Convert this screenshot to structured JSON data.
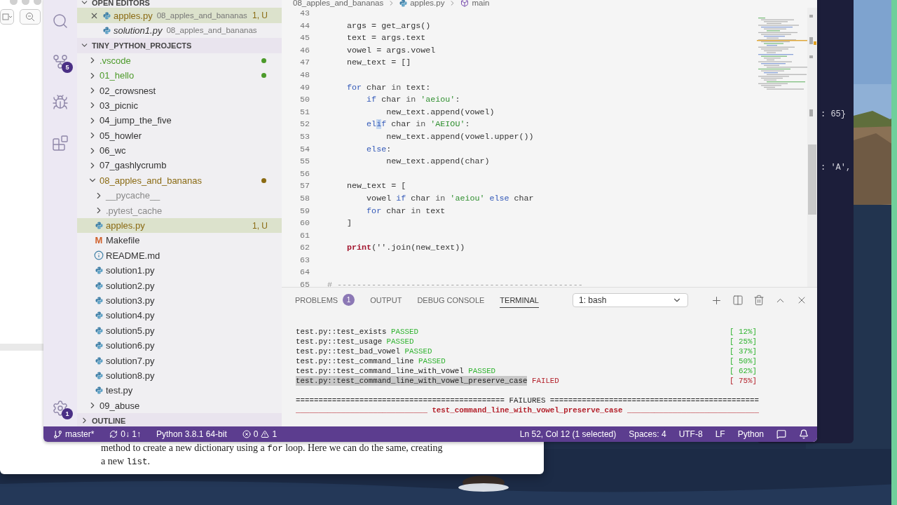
{
  "reader_window": {
    "paragraph": [
      [
        {
          "kind": "text",
          "text": "method to create a new dictionary using a "
        },
        {
          "kind": "code",
          "text": "for"
        },
        {
          "kind": "text",
          "text": " loop. Here we can do the same, creating"
        }
      ],
      [
        {
          "kind": "text",
          "text": "a new "
        },
        {
          "kind": "code",
          "text": "list"
        },
        {
          "kind": "text",
          "text": "."
        }
      ]
    ]
  },
  "terminal_window": {
    "lines": [
      ": 65}",
      ": 'A',"
    ]
  },
  "activity_bar": [
    {
      "kind": "search"
    },
    {
      "kind": "source_control",
      "badge": "5"
    },
    {
      "kind": "debug"
    },
    {
      "kind": "extensions"
    },
    {
      "kind": "settings",
      "badge": "1"
    }
  ],
  "open_editors": {
    "title": "OPEN EDITORS",
    "items": [
      {
        "name": "apples.py",
        "folder": "08_apples_and_bananas",
        "badge": "1, U",
        "selected": true,
        "preview": false,
        "color": "#8a6a12"
      },
      {
        "name": "solution1.py",
        "folder": "08_apples_and_bananas",
        "selected": false,
        "preview": true
      }
    ]
  },
  "explorer": {
    "title": "TINY_PYTHON_PROJECTS",
    "items": [
      {
        "name": ".vscode",
        "kind": "folder",
        "expanded": false,
        "color": "#4c9a2a",
        "dot": true
      },
      {
        "name": "01_hello",
        "kind": "folder",
        "expanded": false,
        "color": "#4c9a2a",
        "dot": true
      },
      {
        "name": "02_crowsnest",
        "kind": "folder",
        "expanded": false
      },
      {
        "name": "03_picnic",
        "kind": "folder",
        "expanded": false
      },
      {
        "name": "04_jump_the_five",
        "kind": "folder",
        "expanded": false
      },
      {
        "name": "05_howler",
        "kind": "folder",
        "expanded": false
      },
      {
        "name": "06_wc",
        "kind": "folder",
        "expanded": false
      },
      {
        "name": "07_gashlycrumb",
        "kind": "folder",
        "expanded": false
      },
      {
        "name": "08_apples_and_bananas",
        "kind": "folder",
        "expanded": true,
        "color": "#8a6a12",
        "dot": true,
        "children": [
          {
            "name": "__pycache__",
            "kind": "folder",
            "expanded": false,
            "color": "#8a8a8a"
          },
          {
            "name": ".pytest_cache",
            "kind": "folder",
            "expanded": false,
            "color": "#8a8a8a"
          },
          {
            "name": "apples.py",
            "kind": "python",
            "selected": true,
            "color": "#8a6a12",
            "badge": "1, U"
          },
          {
            "name": "Makefile",
            "kind": "makefile",
            "icon_glyph": "M",
            "selected": false
          },
          {
            "name": "README.md",
            "kind": "info",
            "selected": false
          },
          {
            "name": "solution1.py",
            "kind": "python",
            "selected": false
          },
          {
            "name": "solution2.py",
            "kind": "python",
            "selected": false
          },
          {
            "name": "solution3.py",
            "kind": "python",
            "selected": false
          },
          {
            "name": "solution4.py",
            "kind": "python",
            "selected": false
          },
          {
            "name": "solution5.py",
            "kind": "python",
            "selected": false
          },
          {
            "name": "solution6.py",
            "kind": "python",
            "selected": false
          },
          {
            "name": "solution7.py",
            "kind": "python",
            "selected": false
          },
          {
            "name": "solution8.py",
            "kind": "python",
            "selected": false
          },
          {
            "name": "test.py",
            "kind": "python",
            "selected": false
          }
        ]
      },
      {
        "name": "09_abuse",
        "kind": "folder",
        "expanded": false
      }
    ]
  },
  "outline": {
    "title": "OUTLINE",
    "expanded": false
  },
  "breadcrumb": [
    {
      "kind": "folder",
      "text": "08_apples_and_bananas"
    },
    {
      "kind": "python",
      "text": "apples.py"
    },
    {
      "kind": "symbol",
      "text": "main"
    }
  ],
  "code": [
    {
      "number": "43"
    },
    {
      "number": "44",
      "tokens": [
        {
          "text": "    args = get_args()",
          "kind": "plain"
        }
      ]
    },
    {
      "number": "45",
      "tokens": [
        {
          "text": "    text = args.text",
          "kind": "plain"
        }
      ]
    },
    {
      "number": "46",
      "tokens": [
        {
          "text": "    vowel = args.vowel",
          "kind": "plain"
        }
      ]
    },
    {
      "number": "47",
      "tokens": [
        {
          "text": "    new_text = []",
          "kind": "plain"
        }
      ]
    },
    {
      "number": "48"
    },
    {
      "number": "49",
      "tokens": [
        {
          "text": "    for",
          "kind": "keyword"
        },
        {
          "text": " char ",
          "kind": "plain"
        },
        {
          "text": "in",
          "kind": "operator"
        },
        {
          "text": " text:",
          "kind": "plain"
        }
      ]
    },
    {
      "number": "50",
      "tokens": [
        {
          "text": "        if",
          "kind": "keyword"
        },
        {
          "text": " char ",
          "kind": "plain"
        },
        {
          "text": "in",
          "kind": "operator"
        },
        {
          "text": " 'aeiou'",
          "kind": "string"
        },
        {
          "text": ":",
          "kind": "plain"
        }
      ]
    },
    {
      "number": "51",
      "tokens": [
        {
          "text": "            new_text.append(vowel)",
          "kind": "plain"
        }
      ]
    },
    {
      "number": "52",
      "tokens": [
        {
          "text": "        el",
          "kind": "keyword"
        },
        {
          "text": "i",
          "kind": "selection"
        },
        {
          "text": "f",
          "kind": "keyword"
        },
        {
          "text": " char ",
          "kind": "plain"
        },
        {
          "text": "in",
          "kind": "operator"
        },
        {
          "text": " 'AEIOU'",
          "kind": "string"
        },
        {
          "text": ":",
          "kind": "plain"
        }
      ]
    },
    {
      "number": "53",
      "tokens": [
        {
          "text": "            new_text.append(vowel.upper())",
          "kind": "plain"
        }
      ]
    },
    {
      "number": "54",
      "tokens": [
        {
          "text": "        else",
          "kind": "keyword"
        },
        {
          "text": ":",
          "kind": "plain"
        }
      ]
    },
    {
      "number": "55",
      "tokens": [
        {
          "text": "            new_text.append(char)",
          "kind": "plain"
        }
      ]
    },
    {
      "number": "56"
    },
    {
      "number": "57",
      "tokens": [
        {
          "text": "    new_text = [",
          "kind": "plain"
        }
      ]
    },
    {
      "number": "58",
      "tokens": [
        {
          "text": "        vowel ",
          "kind": "plain"
        },
        {
          "text": "if",
          "kind": "keyword"
        },
        {
          "text": " char ",
          "kind": "plain"
        },
        {
          "text": "in",
          "kind": "operator"
        },
        {
          "text": " 'aeiou' ",
          "kind": "string"
        },
        {
          "text": "else",
          "kind": "keyword"
        },
        {
          "text": " char",
          "kind": "plain"
        }
      ]
    },
    {
      "number": "59",
      "tokens": [
        {
          "text": "        for",
          "kind": "keyword"
        },
        {
          "text": " char ",
          "kind": "plain"
        },
        {
          "text": "in",
          "kind": "operator"
        },
        {
          "text": " text",
          "kind": "plain"
        }
      ]
    },
    {
      "number": "60",
      "tokens": [
        {
          "text": "    ]",
          "kind": "plain"
        }
      ]
    },
    {
      "number": "61"
    },
    {
      "number": "62",
      "tokens": [
        {
          "text": "    print",
          "kind": "builtin"
        },
        {
          "text": "(''.join(new_text))",
          "kind": "plain"
        }
      ]
    },
    {
      "number": "63"
    },
    {
      "number": "64"
    },
    {
      "number": "65",
      "tokens": [
        {
          "text": "# --------------------------------------------------",
          "kind": "comment"
        }
      ]
    }
  ],
  "panel": {
    "tabs": [
      {
        "label": "PROBLEMS",
        "badge": "1",
        "selected": false
      },
      {
        "label": "OUTPUT",
        "selected": false
      },
      {
        "label": "DEBUG CONSOLE",
        "selected": false
      },
      {
        "label": "TERMINAL",
        "selected": true
      }
    ],
    "terminal_select": "1: bash",
    "rows": [
      {
        "test": "test.py::test_exists",
        "result": "PASSED",
        "passed": true,
        "progress": "[ 12%]",
        "selected": false
      },
      {
        "test": "test.py::test_usage",
        "result": "PASSED",
        "passed": true,
        "progress": "[ 25%]",
        "selected": false
      },
      {
        "test": "test.py::test_bad_vowel",
        "result": "PASSED",
        "passed": true,
        "progress": "[ 37%]",
        "selected": false
      },
      {
        "test": "test.py::test_command_line",
        "result": "PASSED",
        "passed": true,
        "progress": "[ 50%]",
        "selected": false
      },
      {
        "test": "test.py::test_command_line_with_vowel",
        "result": "PASSED",
        "passed": true,
        "progress": "[ 62%]",
        "selected": false
      },
      {
        "test": "test.py::test_command_line_with_vowel_preserve_case",
        "result": "FAILED",
        "passed": false,
        "progress": "[ 75%]",
        "selected": true
      }
    ],
    "failures_header": "============================================== FAILURES ==============================================",
    "failure_title": "_____________________________ test_command_line_with_vowel_preserve_case _____________________________"
  },
  "status_bar": {
    "branch": "master*",
    "sync": "0↓ 1↑",
    "interpreter": "Python 3.8.1 64-bit",
    "errors": "0",
    "warnings": "1",
    "right": [
      "Ln 52, Col 12 (1 selected)",
      "Spaces: 4",
      "UTF-8",
      "LF",
      "Python"
    ]
  }
}
